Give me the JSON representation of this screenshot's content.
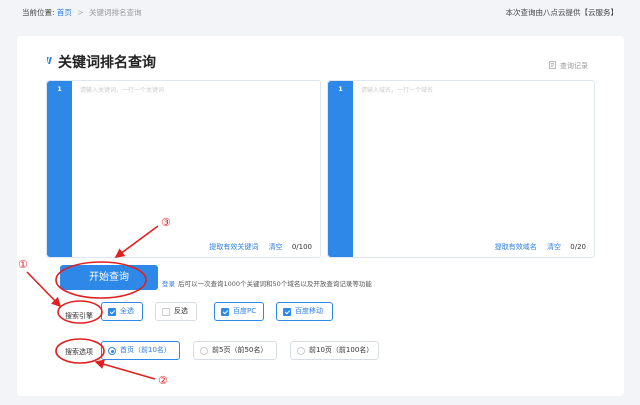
{
  "breadcrumb": {
    "prefix": "当前位置:",
    "home": "首页",
    "separator": ">",
    "current": "关键词排名查询"
  },
  "provider_text": "本次查询由八点云提供【云服务】",
  "page_title": "关键词排名查询",
  "history_link": "查询记录",
  "keyword_editor": {
    "line_number": "1",
    "placeholder": "请输入关键词，一行一个关键词",
    "extract_label": "提取有效关键词",
    "clear_label": "清空",
    "count": "0/100"
  },
  "domain_editor": {
    "line_number": "1",
    "placeholder": "请输入域名，一行一个域名",
    "extract_label": "提取有效域名",
    "clear_label": "清空",
    "count": "0/20"
  },
  "start_button": "开始查询",
  "login_tip": {
    "login": "登录",
    "text": "后可以一次查询1000个关键词和50个域名以及开放查询记录等功能"
  },
  "engine_row": {
    "label": "搜索引擎",
    "options": [
      {
        "label": "全选",
        "checked": true
      },
      {
        "label": "反选",
        "checked": false
      },
      {
        "label": "百度PC",
        "checked": true
      },
      {
        "label": "百度移动",
        "checked": true
      }
    ]
  },
  "range_row": {
    "label": "搜索选项",
    "options": [
      {
        "label": "首页（前10名）",
        "selected": true
      },
      {
        "label": "前5页（前50名）",
        "selected": false
      },
      {
        "label": "前10页（前100名）",
        "selected": false
      }
    ]
  },
  "annotations": [
    "①",
    "②",
    "③"
  ],
  "colors": {
    "accent": "#2e88e8",
    "annotation": "#e02020",
    "link": "#2b7de1"
  }
}
